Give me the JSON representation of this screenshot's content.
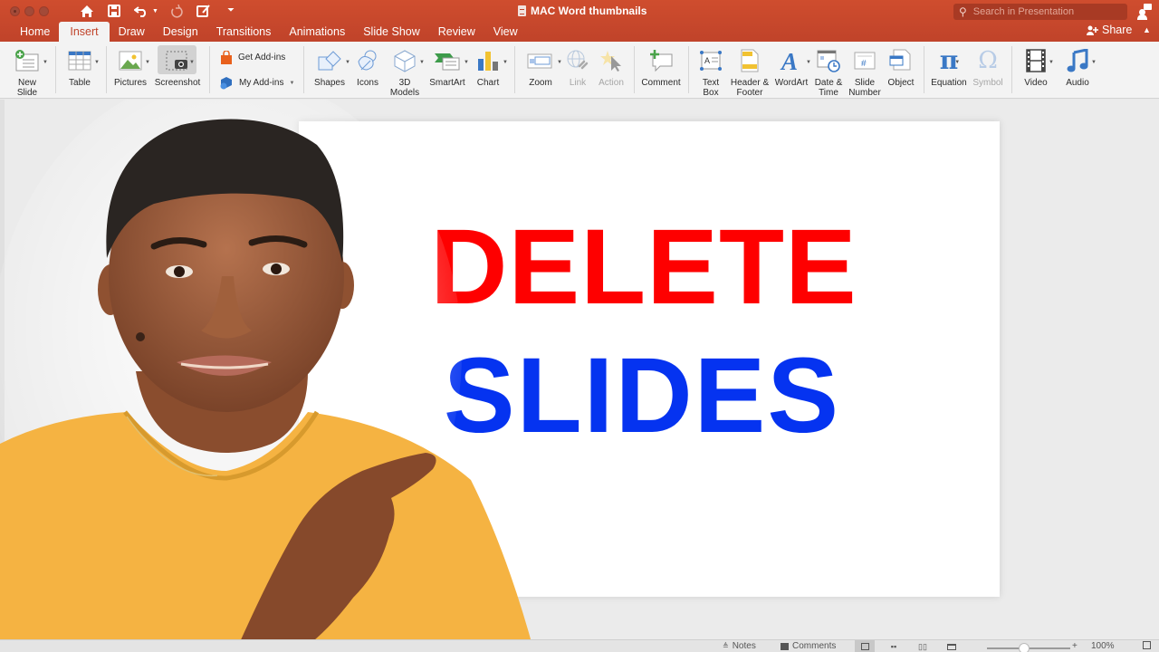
{
  "window": {
    "title": "MAC Word thumbnails",
    "search_placeholder": "Search in Presentation"
  },
  "quick_access": [
    {
      "name": "home-icon",
      "glyph": "⌂"
    },
    {
      "name": "save-icon",
      "glyph": "▣"
    },
    {
      "name": "undo-icon",
      "glyph": "↶"
    },
    {
      "name": "redo-icon",
      "glyph": "↻"
    },
    {
      "name": "edit-icon",
      "glyph": "✎"
    },
    {
      "name": "customize-icon",
      "glyph": "⏷"
    }
  ],
  "tabs": [
    {
      "label": "Home",
      "active": false
    },
    {
      "label": "Insert",
      "active": true
    },
    {
      "label": "Draw",
      "active": false
    },
    {
      "label": "Design",
      "active": false
    },
    {
      "label": "Transitions",
      "active": false
    },
    {
      "label": "Animations",
      "active": false
    },
    {
      "label": "Slide Show",
      "active": false
    },
    {
      "label": "Review",
      "active": false
    },
    {
      "label": "View",
      "active": false
    }
  ],
  "share_label": "Share",
  "ribbon": {
    "new_slide": "New\nSlide",
    "table": "Table",
    "pictures": "Pictures",
    "screenshot": "Screenshot",
    "get_addins": "Get Add-ins",
    "my_addins": "My Add-ins",
    "shapes": "Shapes",
    "icons": "Icons",
    "models_3d": "3D\nModels",
    "smartart": "SmartArt",
    "chart": "Chart",
    "zoom": "Zoom",
    "link": "Link",
    "action": "Action",
    "comment": "Comment",
    "text_box": "Text\nBox",
    "header_footer": "Header &\nFooter",
    "wordart": "WordArt",
    "date_time": "Date &\nTime",
    "slide_number": "Slide\nNumber",
    "object": "Object",
    "equation": "Equation",
    "symbol": "Symbol",
    "video": "Video",
    "audio": "Audio"
  },
  "slide": {
    "line1": "DELETE",
    "line2": "SLIDES",
    "line1_color": "#fe0000",
    "line2_color": "#0533f0"
  },
  "statusbar": {
    "notes": "Notes",
    "comments": "Comments",
    "zoom_level": "100%",
    "zoom_value": 100
  },
  "colors": {
    "accent": "#c0432a",
    "ribbon_bg": "#f3f3f3",
    "shirt": "#f5b342"
  }
}
